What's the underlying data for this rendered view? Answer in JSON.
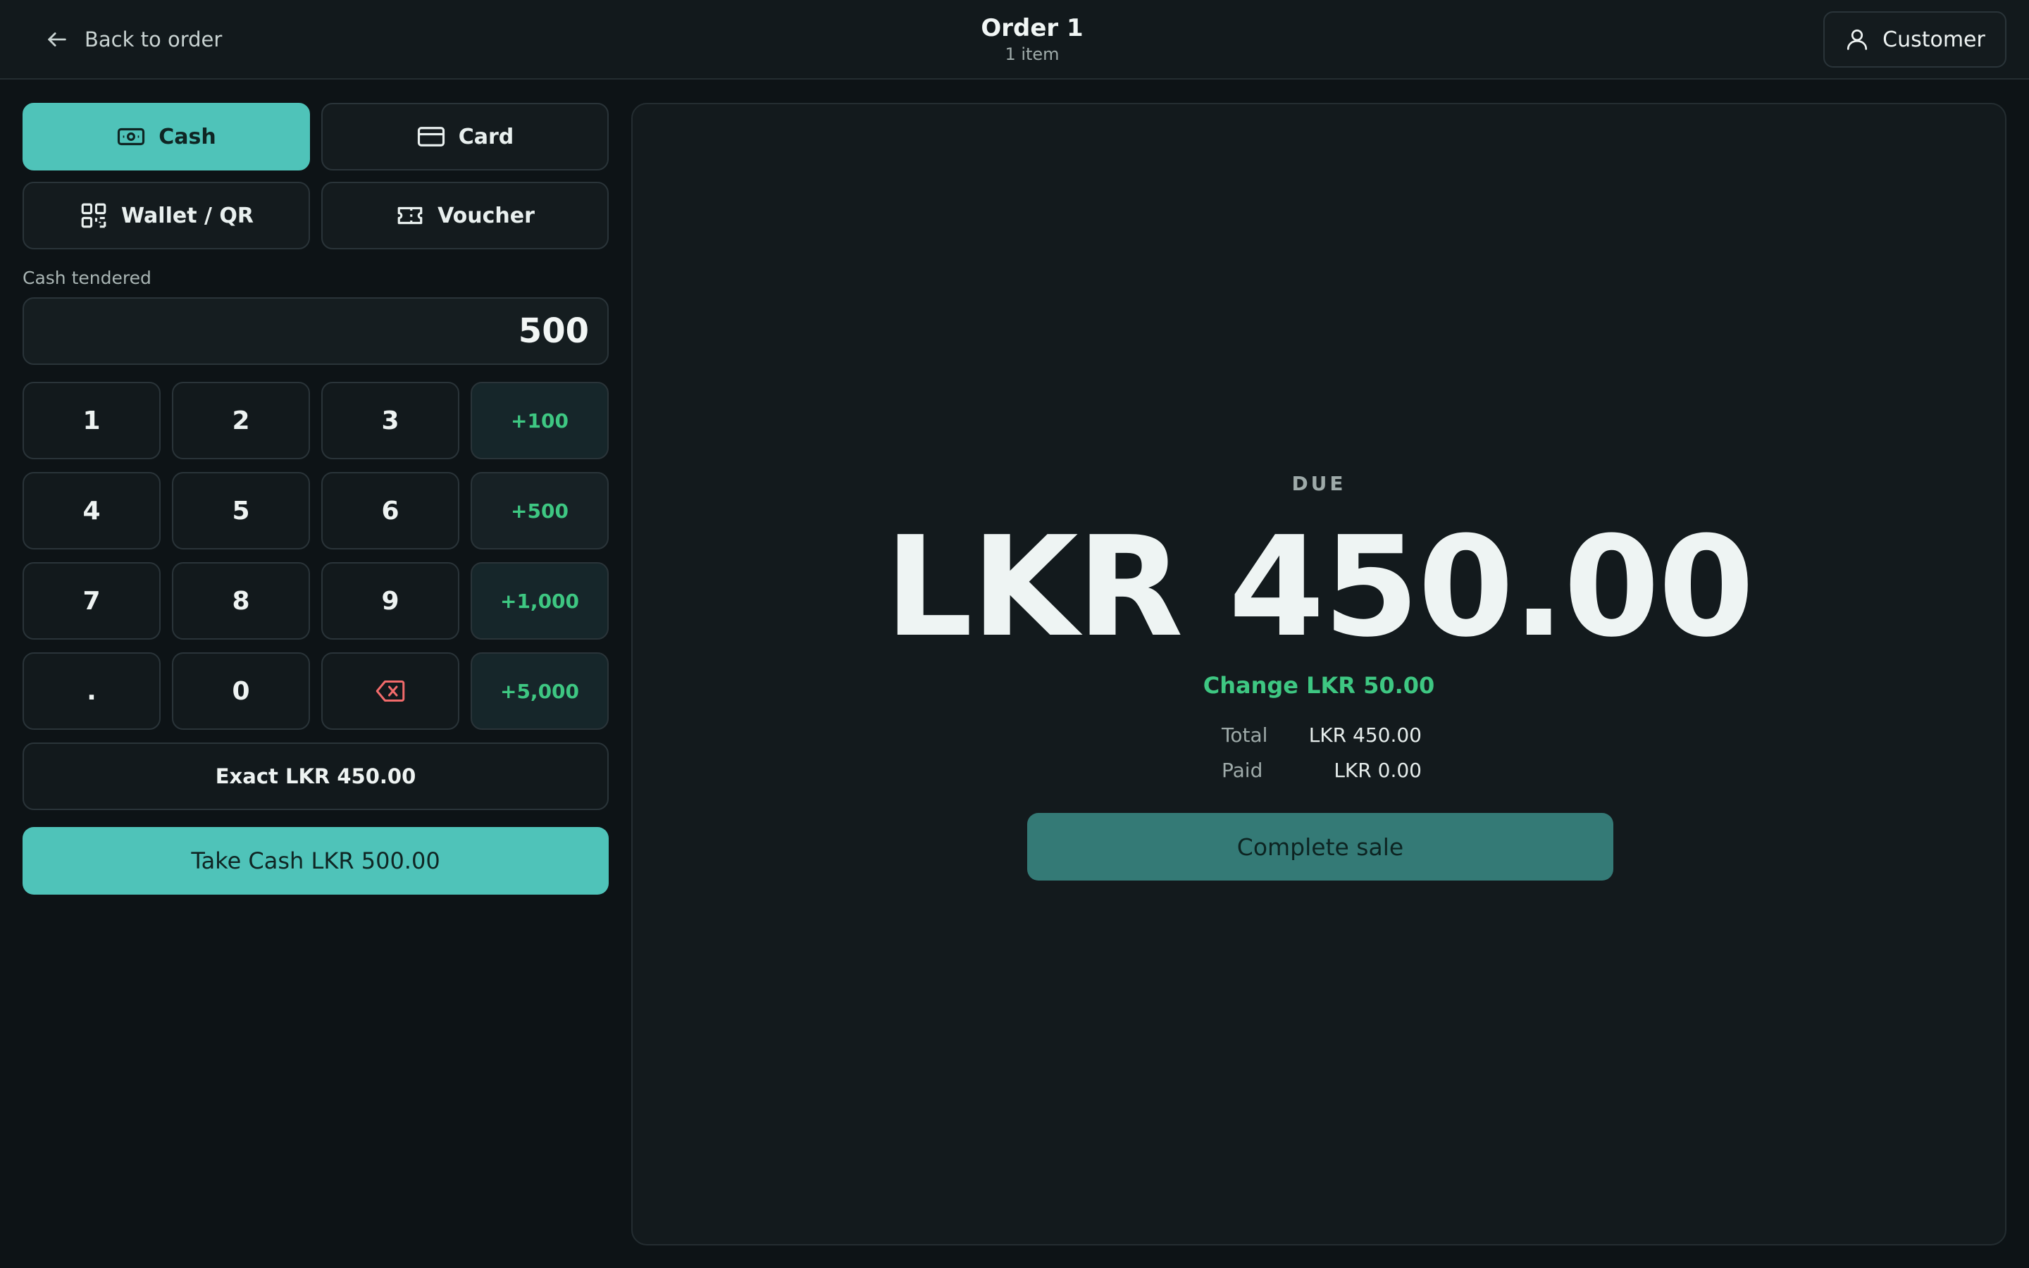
{
  "header": {
    "back_label": "Back to order",
    "order_title": "Order 1",
    "order_subtitle": "1 item",
    "customer_label": "Customer"
  },
  "payment_methods": {
    "cash": "Cash",
    "card": "Card",
    "wallet": "Wallet / QR",
    "voucher": "Voucher",
    "active": "Cash"
  },
  "tender": {
    "label": "Cash tendered",
    "value": "500"
  },
  "keypad": {
    "k1": "1",
    "k2": "2",
    "k3": "3",
    "k4": "4",
    "k5": "5",
    "k6": "6",
    "k7": "7",
    "k8": "8",
    "k9": "9",
    "kdot": ".",
    "k0": "0",
    "q100": "+100",
    "q500": "+500",
    "q1000": "+1,000",
    "q5000": "+5,000"
  },
  "actions": {
    "exact_label": "Exact LKR 450.00",
    "take_cash_label": "Take Cash LKR 500.00",
    "complete_label": "Complete sale"
  },
  "due": {
    "label": "DUE",
    "amount": "LKR 450.00",
    "change": "Change LKR 50.00",
    "total_label": "Total",
    "total_value": "LKR 450.00",
    "paid_label": "Paid",
    "paid_value": "LKR 0.00"
  },
  "colors": {
    "accent": "#4fc3b9",
    "positive": "#3ec782",
    "danger": "#f26b6b",
    "background": "#0d1316"
  }
}
